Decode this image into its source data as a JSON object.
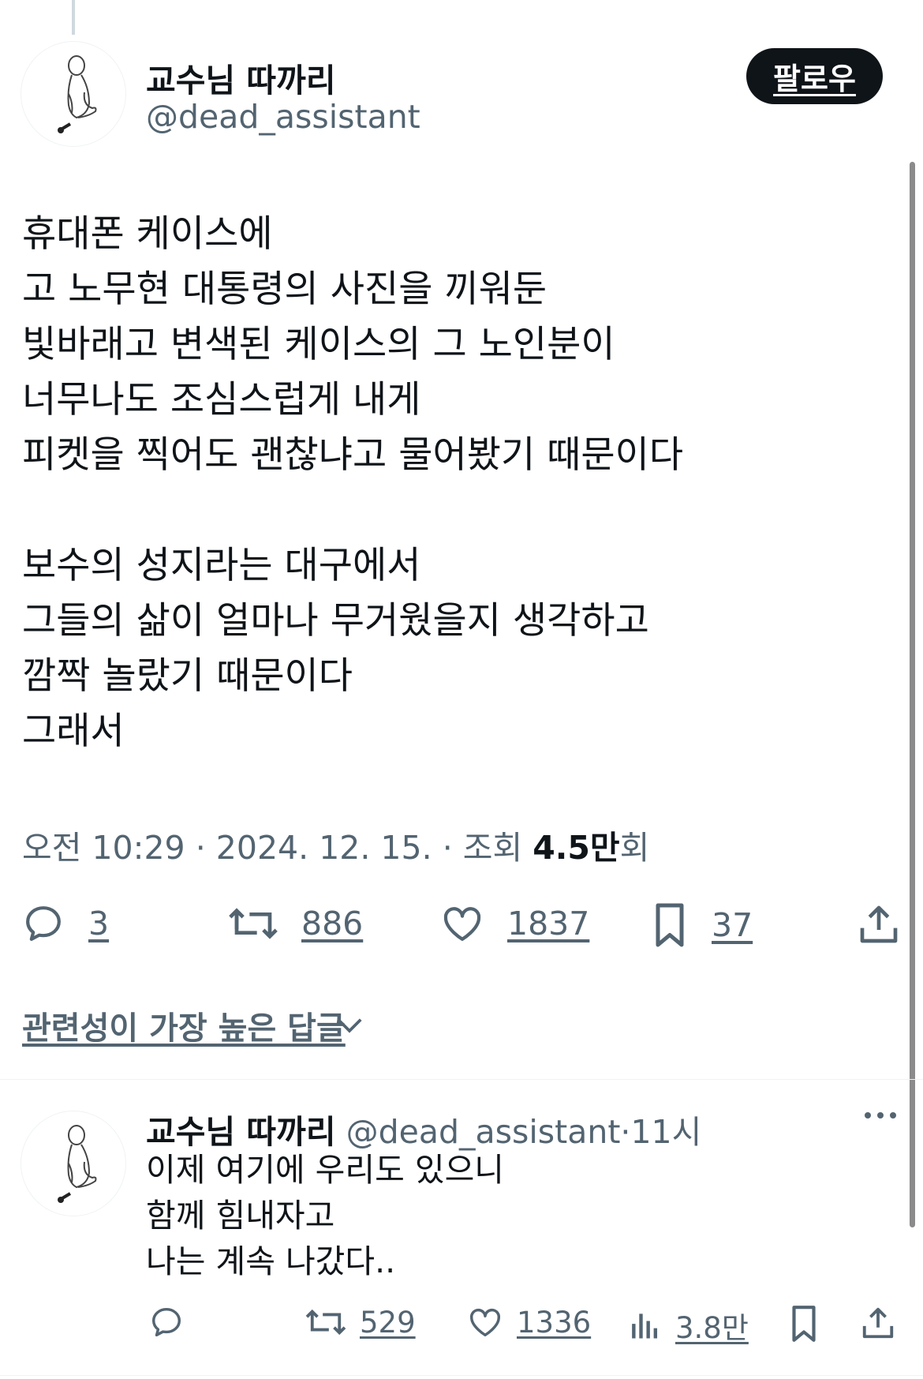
{
  "main_tweet": {
    "author_name": "교수님 따까리",
    "author_handle": "@dead_assistant",
    "follow_label": "팔로우",
    "text_lines": [
      "휴대폰 케이스에",
      "고 노무현 대통령의 사진을 끼워둔",
      "빛바래고 변색된 케이스의 그 노인분이",
      "너무나도 조심스럽게 내게",
      "피켓을 찍어도 괜찮냐고 물어봤기 때문이다",
      "",
      "보수의 성지라는 대구에서",
      "그들의 삶이 얼마나 무거웠을지 생각하고",
      "깜짝 놀랐기 때문이다",
      "그래서"
    ],
    "time": "오전 10:29",
    "date": "2024. 12. 15.",
    "views_prefix": "조회",
    "views_value": "4.5만",
    "views_suffix": "회",
    "separator": "·",
    "stats": {
      "replies": "3",
      "retweets": "886",
      "likes": "1837",
      "bookmarks": "37"
    }
  },
  "relevant_replies_label": "관련성이 가장 높은 답글",
  "reply": {
    "author_name": "교수님 따까리",
    "author_handle": "@dead_assistant",
    "separator": "·",
    "time_ago": "11시",
    "text_lines": [
      "이제 여기에 우리도 있으니",
      "함께 힘내자고",
      "나는 계속 나갔다.."
    ],
    "stats": {
      "retweets": "529",
      "likes": "1336",
      "views": "3.8만"
    }
  },
  "icons": {
    "reply": "reply-icon",
    "retweet": "retweet-icon",
    "like": "heart-icon",
    "bookmark": "bookmark-icon",
    "share": "share-icon",
    "views": "views-chart-icon",
    "more": "more-dots-icon",
    "chevron": "chevron-down-icon"
  },
  "colors": {
    "text": "#0f1419",
    "secondary": "#536471",
    "button_bg": "#0f1419",
    "divider": "#eff3f4"
  }
}
